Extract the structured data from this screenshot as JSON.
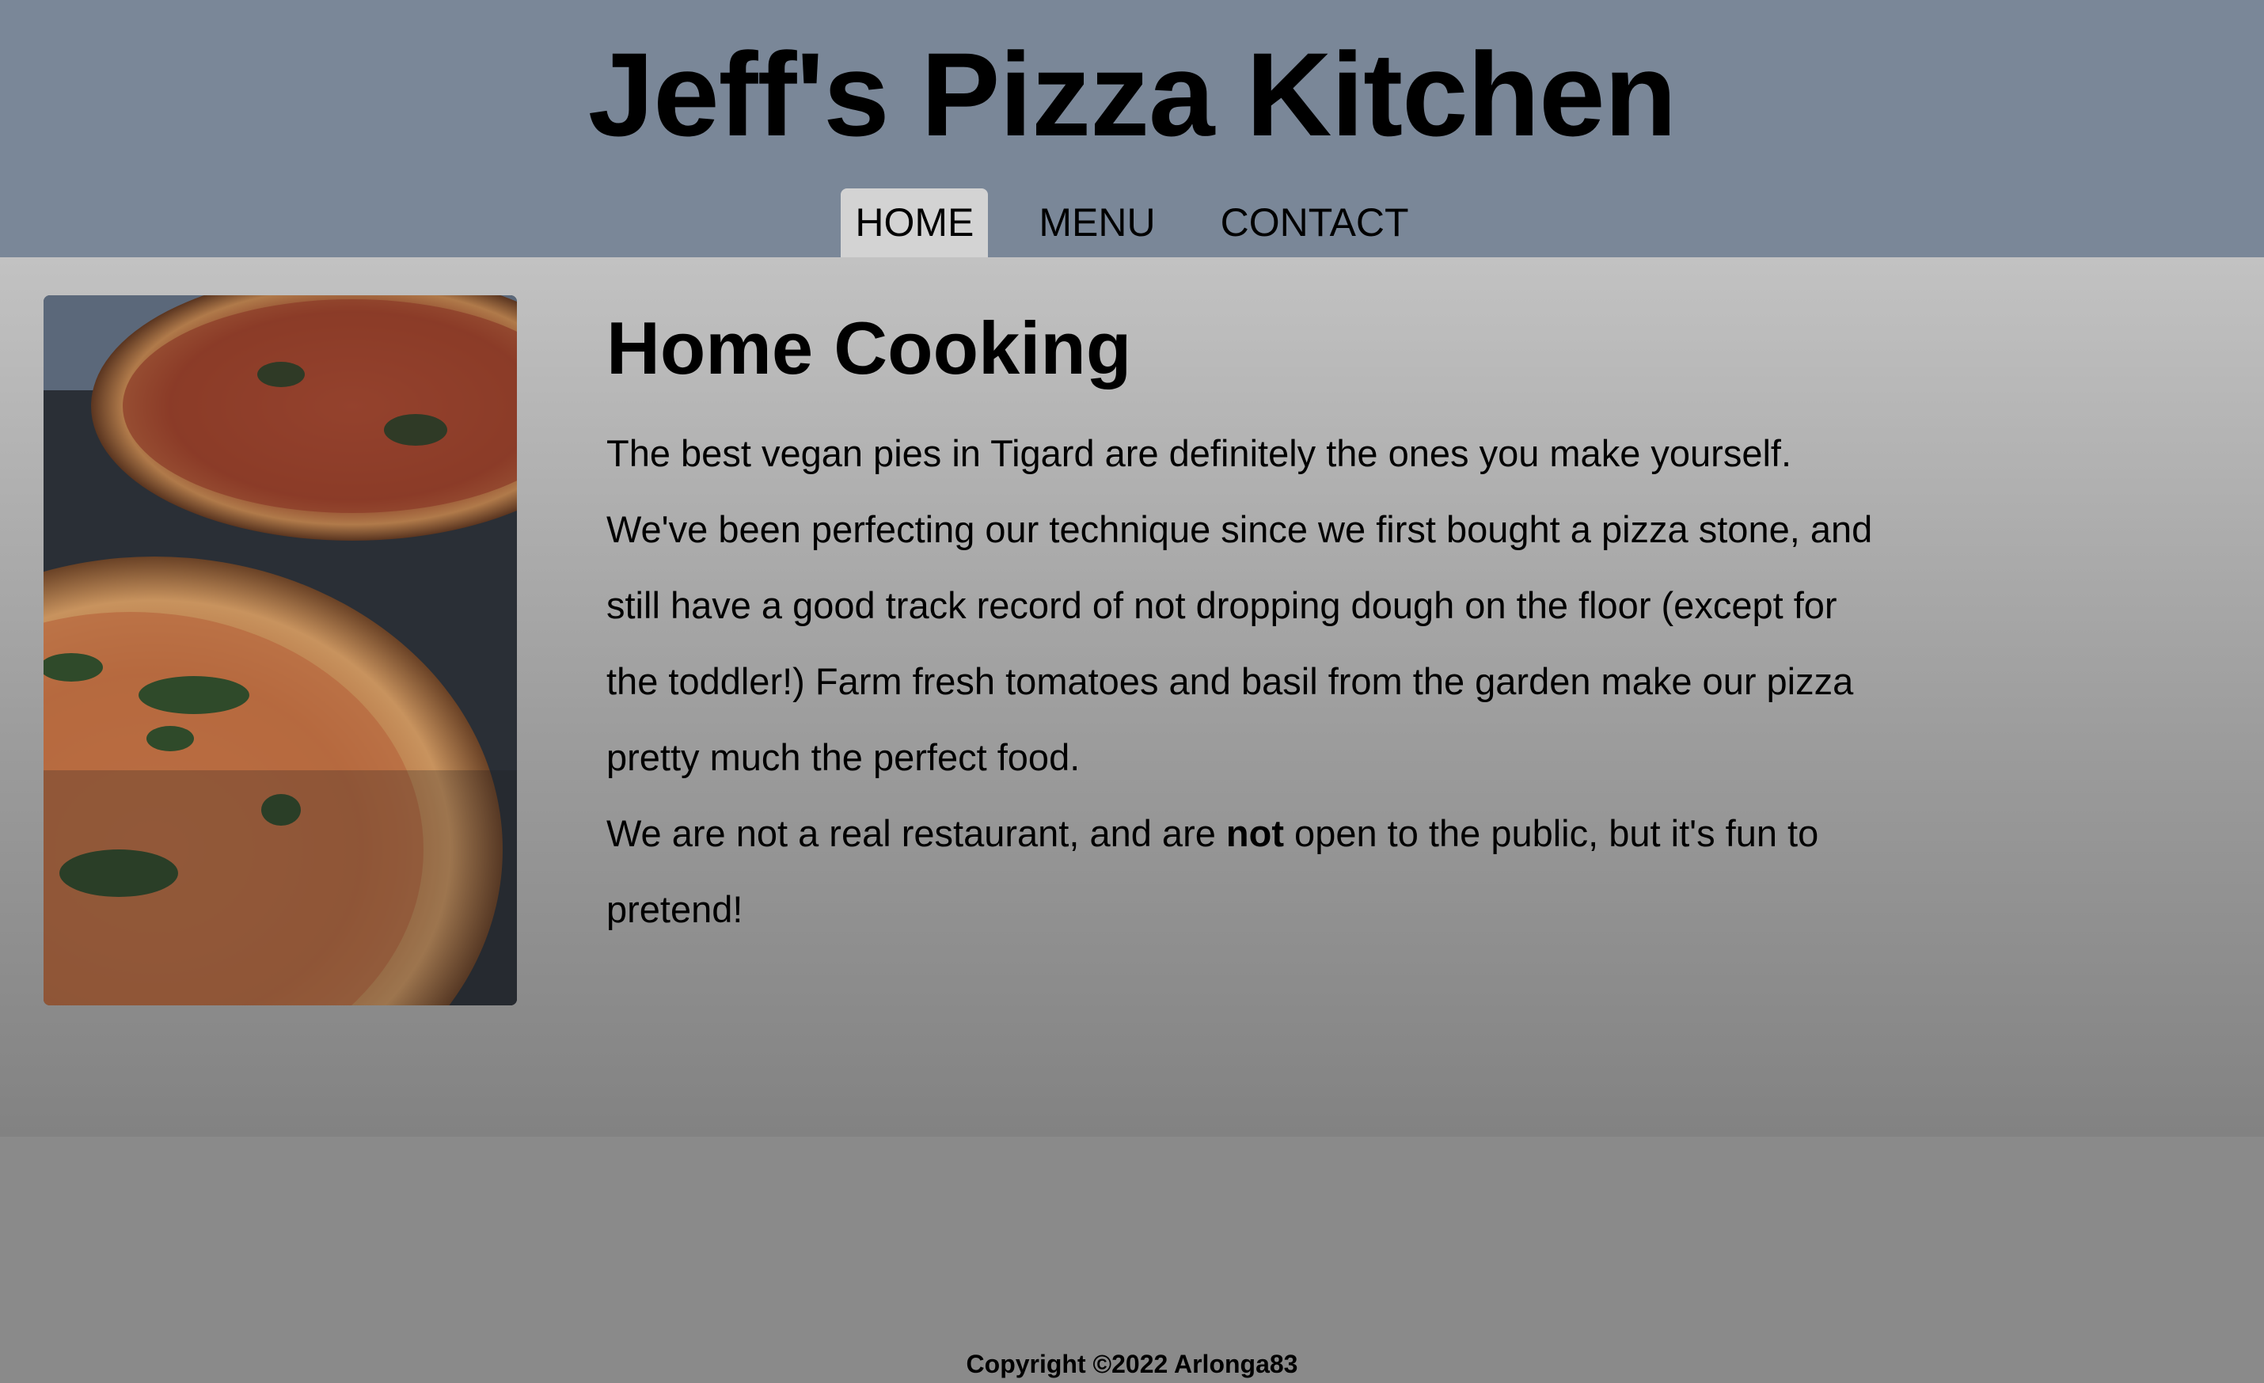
{
  "header": {
    "site_title": "Jeff's Pizza Kitchen"
  },
  "nav": {
    "items": [
      {
        "label": "HOME",
        "active": true
      },
      {
        "label": "MENU",
        "active": false
      },
      {
        "label": "CONTACT",
        "active": false
      }
    ]
  },
  "main": {
    "image_alt": "pizza",
    "heading": "Home Cooking",
    "paragraph1": "The best vegan pies in Tigard are definitely the ones you make yourself. We've been perfecting our technique since we first bought a pizza stone, and still have a good track record of not dropping dough on the floor (except for the toddler!) Farm fresh tomatoes and basil from the garden make our pizza pretty much the perfect food.",
    "paragraph2_before": "We are not a real restaurant, and are ",
    "paragraph2_bold": "not",
    "paragraph2_after": " open to the public, but it's fun to pretend!"
  },
  "footer": {
    "copyright": "Copyright ©2022 Arlonga83"
  },
  "colors": {
    "header_bg": "#7a8798",
    "nav_active_bg": "#d3d3d3",
    "main_bg_top": "#c2c2c2",
    "main_bg_bottom": "#828282"
  }
}
